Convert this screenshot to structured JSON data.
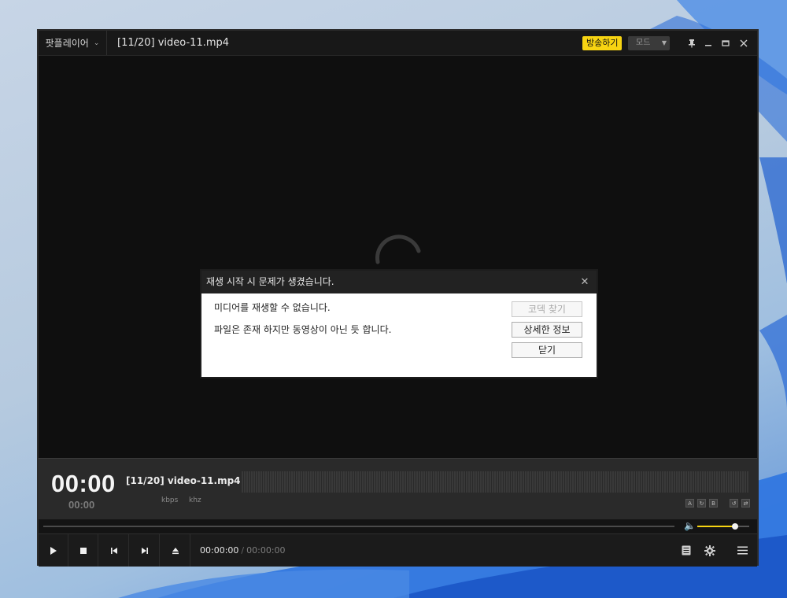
{
  "window": {
    "app_menu_label": "팟플레이어",
    "title": "[11/20] video-11.mp4",
    "broadcast_label": "방송하기",
    "mode_label": "모드"
  },
  "dialog": {
    "title": "재생 시작 시 문제가 생겼습니다.",
    "message_1": "미디어를 재생할 수 없습니다.",
    "message_2": "파일은 존재 하지만 동영상이 아닌 듯 합니다.",
    "codec_button": "코덱 찾기",
    "details_button": "상세한 정보",
    "close_button": "닫기"
  },
  "info": {
    "time_elapsed": "00:00",
    "time_total": "00:00",
    "track_title": "[11/20] video-11.mp4",
    "kbps_label": "kbps",
    "khz_label": "khz",
    "mini_a": "A",
    "mini_b": "B"
  },
  "volume": {
    "level": 0.72
  },
  "controls": {
    "current_time": "00:00:00",
    "separator": "/",
    "total_time": "00:00:00"
  },
  "colors": {
    "accent": "#f7d412",
    "background": "#101010"
  }
}
